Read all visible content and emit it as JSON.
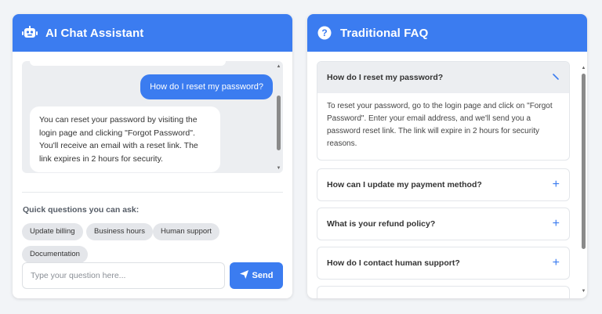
{
  "colors": {
    "accent": "#3b7cf0",
    "panel_bg": "#ffffff",
    "chat_bg": "#eceef1",
    "chip_bg": "#e4e6ea"
  },
  "chat": {
    "title": "AI Chat Assistant",
    "header_icon": "robot-icon",
    "messages": [
      {
        "role": "user",
        "text": "How do I reset my password?"
      },
      {
        "role": "bot",
        "text": "You can reset your password by visiting the login page and clicking \"Forgot Password\". You'll receive an email with a reset link. The link expires in 2 hours for security."
      }
    ],
    "quick_label": "Quick questions you can ask:",
    "chips": [
      "Update billing",
      "Business hours",
      "Human support",
      "Documentation"
    ],
    "input_placeholder": "Type your question here...",
    "send_label": "Send",
    "send_icon": "paper-plane-icon"
  },
  "faq": {
    "title": "Traditional FAQ",
    "header_icon": "question-circle-icon",
    "items": [
      {
        "question": "How do I reset my password?",
        "answer": "To reset your password, go to the login page and click on \"Forgot Password\". Enter your email address, and we'll send you a password reset link. The link will expire in 2 hours for security reasons.",
        "open": true
      },
      {
        "question": "How can I update my payment method?",
        "open": false
      },
      {
        "question": "What is your refund policy?",
        "open": false
      },
      {
        "question": "How do I contact human support?",
        "open": false
      }
    ],
    "collapse_icon": "chevron-icon",
    "expand_icon": "plus-icon"
  }
}
